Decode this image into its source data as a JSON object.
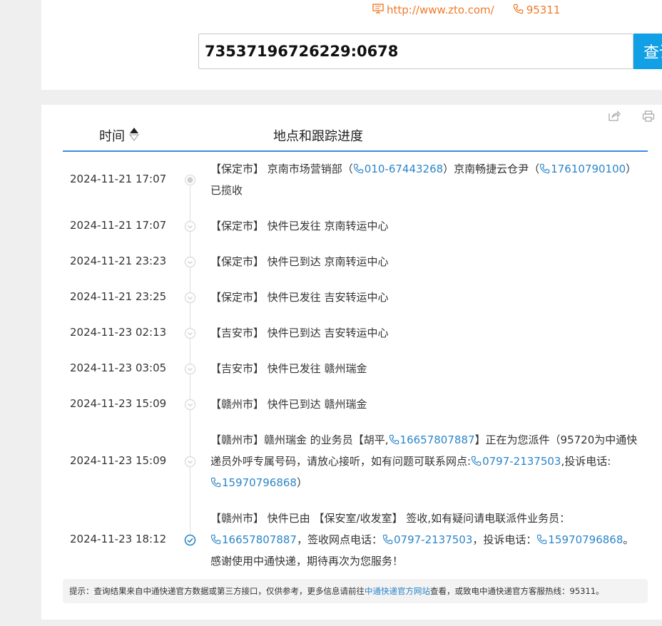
{
  "header": {
    "website": "http://www.zto.com/",
    "hotline": "95311"
  },
  "search": {
    "value": "73537196726229:0678",
    "button_label": "查询"
  },
  "table": {
    "col_time": "时间",
    "col_place": "地点和跟踪进度"
  },
  "records": [
    {
      "time": "2024-11-21 17:07",
      "status": "start",
      "parts": [
        "【保定市】 京南市场营销部（",
        {
          "tel": "010-67443268"
        },
        "）京南畅捷云仓尹（",
        {
          "tel": "17610790100"
        },
        "） 已揽收"
      ]
    },
    {
      "time": "2024-11-21 17:07",
      "status": "normal",
      "parts": [
        "【保定市】 快件已发往 京南转运中心"
      ]
    },
    {
      "time": "2024-11-21 23:23",
      "status": "normal",
      "parts": [
        "【保定市】 快件已到达 京南转运中心"
      ]
    },
    {
      "time": "2024-11-21 23:25",
      "status": "normal",
      "parts": [
        "【保定市】 快件已发往 吉安转运中心"
      ]
    },
    {
      "time": "2024-11-23 02:13",
      "status": "normal",
      "parts": [
        "【吉安市】 快件已到达 吉安转运中心"
      ]
    },
    {
      "time": "2024-11-23 03:05",
      "status": "normal",
      "parts": [
        "【吉安市】 快件已发往 赣州瑞金"
      ]
    },
    {
      "time": "2024-11-23 15:09",
      "status": "normal",
      "parts": [
        "【赣州市】 快件已到达 赣州瑞金"
      ]
    },
    {
      "time": "2024-11-23 15:09",
      "status": "normal",
      "parts": [
        "【赣州市】赣州瑞金 的业务员【胡平,",
        {
          "tel": "16657807887"
        },
        "】正在为您派件（95720为中通快递员外呼专属号码，请放心接听，如有问题可联系网点:",
        {
          "tel": "0797-2137503"
        },
        ",投诉电话:",
        {
          "tel": "15970796868"
        },
        "）"
      ]
    },
    {
      "time": "2024-11-23 18:12",
      "status": "done",
      "parts": [
        "【赣州市】 快件已由 【保安室/收发室】 签收,如有疑问请电联派件业务员：",
        {
          "tel": "16657807887"
        },
        "，签收网点电话：",
        {
          "tel": "0797-2137503"
        },
        "，投诉电话：",
        {
          "tel": "15970796868"
        },
        "。感谢使用中通快递，期待再次为您服务！"
      ]
    }
  ],
  "footer": {
    "prefix": "提示：查询结果来自中通快递官方数据或第三方接口，仅供参考，更多信息请前往",
    "link": "中通快递官方网站",
    "suffix": "查看，或致电中通快递官方客服热线：95311。"
  },
  "colors": {
    "accent": "#11a0e6",
    "link": "#2b85c9",
    "orange": "#f07a2a",
    "line": "#3a8be0"
  }
}
